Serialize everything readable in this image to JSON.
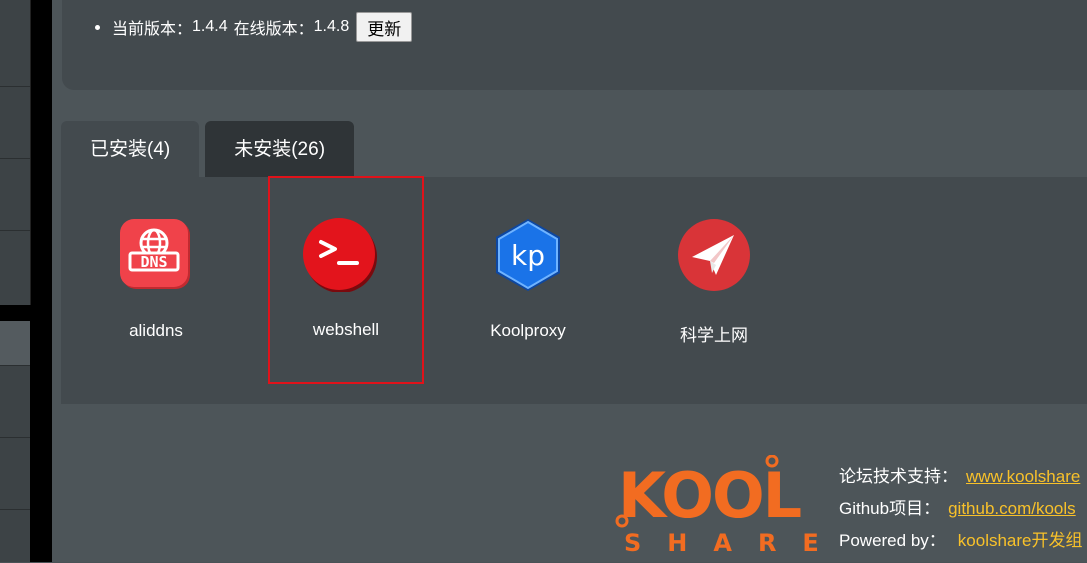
{
  "version": {
    "current_label": "当前版本：",
    "current": "1.4.4",
    "online_label": "在线版本：",
    "online": "1.4.8",
    "update_button": "更新"
  },
  "tabs": [
    {
      "label": "已安装(4)",
      "active": true
    },
    {
      "label": "未安装(26)",
      "active": false
    }
  ],
  "apps": [
    {
      "name": "aliddns",
      "icon": "dns-icon",
      "color": "#f0424a"
    },
    {
      "name": "webshell",
      "icon": "terminal-icon",
      "color": "#e3141c"
    },
    {
      "name": "Koolproxy",
      "icon": "kp-icon",
      "color": "#1a73e8"
    },
    {
      "name": "科学上网",
      "icon": "paper-plane-icon",
      "color": "#d93438"
    }
  ],
  "footer": {
    "logo_text": "KOOL",
    "logo_subtext": "SHARE",
    "forum_label": "论坛技术支持：",
    "forum_link": "www.koolshare",
    "github_label": "Github项目：",
    "github_link": "github.com/kools",
    "powered_label": "Powered by：",
    "powered_value": "koolshare开发组"
  },
  "colors": {
    "accent": "#f8c12a",
    "selected_border": "#e0121a",
    "logo_orange": "#f26c21"
  }
}
